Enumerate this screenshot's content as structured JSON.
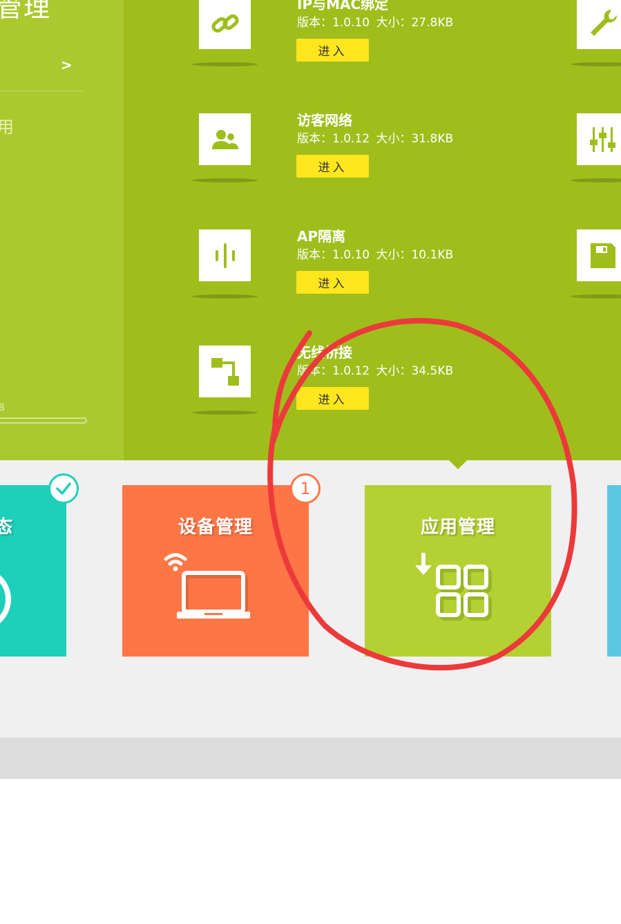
{
  "left_panel": {
    "title_fragment": "管理",
    "arrow": ">",
    "partial_text": "用",
    "small_label": "B",
    "progress_fraction": 0
  },
  "apps": [
    {
      "name": "IP与MAC绑定",
      "version_label": "版本：1.0.10",
      "size_label": "大小：27.8KB",
      "button": "进入",
      "icon": "link-icon"
    },
    {
      "name": "访客网络",
      "version_label": "版本：1.0.12",
      "size_label": "大小：31.8KB",
      "button": "进入",
      "icon": "guest-users-icon"
    },
    {
      "name": "AP隔离",
      "version_label": "版本：1.0.10",
      "size_label": "大小：10.1KB",
      "button": "进入",
      "icon": "ap-isolation-icon"
    },
    {
      "name": "无线桥接",
      "version_label": "版本：1.0.12",
      "size_label": "大小：34.5KB",
      "button": "进入",
      "icon": "bridge-icon"
    }
  ],
  "side_icons": [
    "wrench-icon",
    "sliders-icon",
    "floppy-icon"
  ],
  "tiles": {
    "status": {
      "label": "态",
      "badge": "check-icon",
      "color": "#1ecfba"
    },
    "device": {
      "label": "设备管理",
      "badge_count": "1",
      "color": "#ff7646"
    },
    "app": {
      "label": "应用管理",
      "color": "#b4d033"
    },
    "extra": {
      "color": "#5bc7e3"
    }
  },
  "colors": {
    "panel_green": "#9fbe1c",
    "left_green": "#aac92f",
    "button_yellow": "#ffe61e",
    "annotation_red": "#ec3a3a",
    "background_grey": "#f0f0f0"
  }
}
